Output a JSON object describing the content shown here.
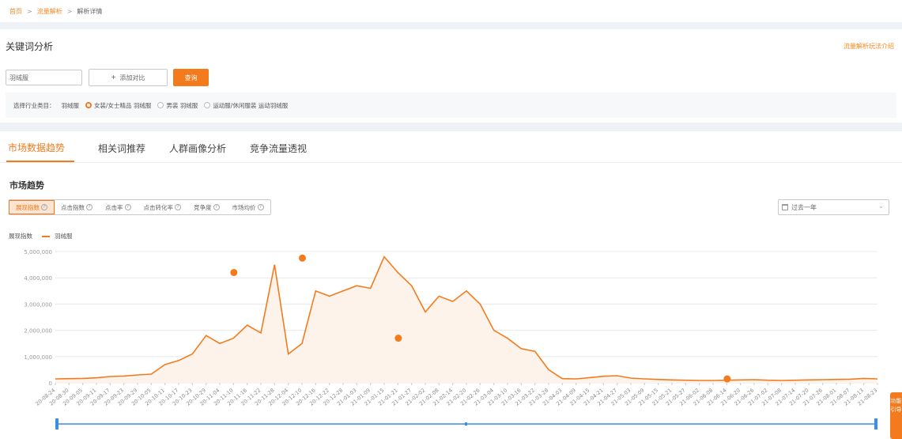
{
  "breadcrumb": {
    "home": "首页",
    "traffic": "流量解析",
    "current": "解析详情",
    "sep": ">"
  },
  "keyword": {
    "title": "关键词分析",
    "guide_link": "流量解析玩法介绍",
    "input_value": "羽绒服",
    "add_compare": "添加对比",
    "query_button": "查询"
  },
  "category": {
    "label": "选择行业类目：",
    "keyword": "羽绒服",
    "options": [
      "女装/女士精品 羽绒服",
      "男装 羽绒服",
      "运动服/休闲服装 运动羽绒服"
    ],
    "selected_index": 0
  },
  "tabs": [
    "市场数据趋势",
    "相关词推荐",
    "人群画像分析",
    "竞争流量透视"
  ],
  "active_tab": 0,
  "section_title": "市场趋势",
  "metrics": [
    "展现指数",
    "点击指数",
    "点击率",
    "点击转化率",
    "竞争度",
    "市场均价"
  ],
  "active_metric": 0,
  "period": {
    "value": "过去一年",
    "icon": "calendar-icon"
  },
  "accent_color": "#f37b1d",
  "side_tab_text": "功能引导",
  "chart_data": {
    "type": "area",
    "legend_label": "展现指数",
    "series_name": "羽绒服",
    "ylim": [
      0,
      5000000
    ],
    "y_ticks": [
      "0",
      "1,000,000",
      "2,000,000",
      "3,000,000",
      "4,000,000",
      "5,000,000"
    ],
    "grid": true,
    "x_ticks": [
      "20-08-24",
      "20-08-30",
      "20-09-05",
      "20-09-11",
      "20-09-17",
      "20-09-23",
      "20-09-29",
      "20-10-05",
      "20-10-11",
      "20-10-17",
      "20-10-23",
      "20-10-29",
      "20-11-04",
      "20-11-10",
      "20-11-16",
      "20-11-22",
      "20-11-28",
      "20-12-04",
      "20-12-10",
      "20-12-16",
      "20-12-22",
      "20-12-28",
      "21-01-03",
      "21-01-09",
      "21-01-15",
      "21-01-21",
      "21-01-27",
      "21-02-02",
      "21-02-08",
      "21-02-14",
      "21-02-20",
      "21-02-26",
      "21-03-04",
      "21-03-10",
      "21-03-16",
      "21-03-22",
      "21-03-28",
      "21-04-03",
      "21-04-09",
      "21-04-15",
      "21-04-21",
      "21-04-27",
      "21-05-03",
      "21-05-09",
      "21-05-15",
      "21-05-21",
      "21-05-27",
      "21-06-02",
      "21-06-08",
      "21-06-14",
      "21-06-20",
      "21-06-26",
      "21-07-02",
      "21-07-08",
      "21-07-14",
      "21-07-20",
      "21-07-26",
      "21-08-01",
      "21-08-07",
      "21-08-13",
      "21-08-23"
    ],
    "values": [
      150000,
      160000,
      170000,
      190000,
      240000,
      260000,
      300000,
      330000,
      700000,
      850000,
      1100000,
      1800000,
      1500000,
      1700000,
      2200000,
      1900000,
      4500000,
      1100000,
      1500000,
      3500000,
      3300000,
      3500000,
      3700000,
      3600000,
      4800000,
      4200000,
      3700000,
      2700000,
      3300000,
      3100000,
      3500000,
      3000000,
      2000000,
      1700000,
      1300000,
      1200000,
      500000,
      160000,
      150000,
      200000,
      250000,
      270000,
      180000,
      150000,
      130000,
      110000,
      100000,
      90000,
      90000,
      100000,
      110000,
      120000,
      100000,
      90000,
      100000,
      110000,
      120000,
      130000,
      140000,
      170000,
      150000
    ],
    "markers": [
      {
        "x": "20-11-10",
        "y": 4200000
      },
      {
        "x": "20-12-10",
        "y": 4750000
      },
      {
        "x": "21-01-21",
        "y": 1700000
      },
      {
        "x": "21-06-14",
        "y": 150000
      }
    ]
  }
}
